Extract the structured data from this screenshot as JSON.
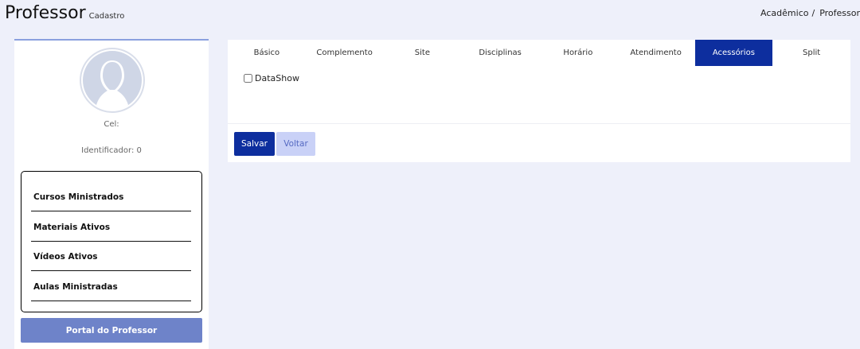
{
  "header": {
    "title": "Professor",
    "subtitle": "Cadastro",
    "breadcrumb": [
      "Acadêmico",
      "/",
      "Professor"
    ]
  },
  "profile": {
    "avatar_icon": "user-placeholder-icon",
    "cel_label": "Cel:",
    "identifier_label": "Identificador: 0",
    "stats": [
      {
        "label": "Cursos Ministrados"
      },
      {
        "label": "Materiais Ativos"
      },
      {
        "label": "Vídeos Ativos"
      },
      {
        "label": "Aulas Ministradas"
      }
    ],
    "portal_button": "Portal do Professor"
  },
  "tabs": [
    {
      "label": "Básico",
      "active": false
    },
    {
      "label": "Complemento",
      "active": false
    },
    {
      "label": "Site",
      "active": false
    },
    {
      "label": "Disciplinas",
      "active": false
    },
    {
      "label": "Horário",
      "active": false
    },
    {
      "label": "Atendimento",
      "active": false
    },
    {
      "label": "Acessórios",
      "active": true
    },
    {
      "label": "Split",
      "active": false
    }
  ],
  "accessories": {
    "datashow_label": "DataShow",
    "datashow_checked": false
  },
  "actions": {
    "save_label": "Salvar",
    "back_label": "Voltar"
  },
  "colors": {
    "primary": "#0d2e9e",
    "portal_button": "#6e83c9",
    "secondary_button": "#c9d1f7",
    "background": "#eef0fa"
  }
}
